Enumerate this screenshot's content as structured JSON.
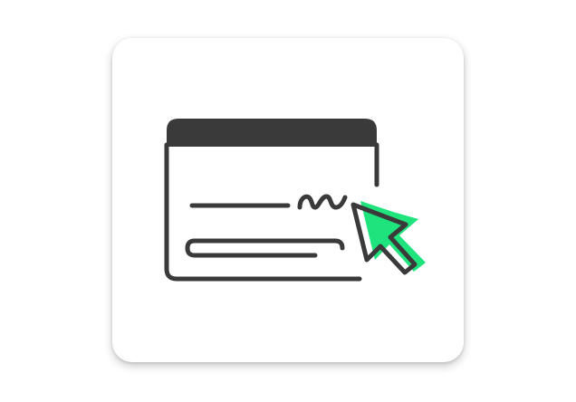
{
  "icon": {
    "name": "e-signature-document-icon",
    "colors": {
      "outline": "#3a3a3a",
      "header_fill": "#3a3a3a",
      "cursor_accent": "#1fe37c",
      "card_background": "#ffffff"
    }
  }
}
